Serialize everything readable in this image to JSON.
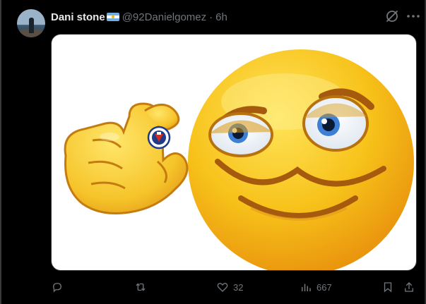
{
  "post": {
    "author_name": "Dani stone",
    "author_handle": "@92Danielgomez",
    "separator": "·",
    "time_ago": "6h",
    "flag_icon": "argentina-flag-icon"
  },
  "media": {
    "icons": [
      "emoji-face",
      "pinching-hand",
      "chile-football-crest"
    ]
  },
  "actions": {
    "reply_count": "",
    "repost_count": "",
    "like_count": "32",
    "views_count": "667"
  },
  "colors": {
    "background": "#000000",
    "text_primary": "#e7e9ea",
    "text_secondary": "#71767b",
    "emoji_yellow": "#f7c21a"
  }
}
